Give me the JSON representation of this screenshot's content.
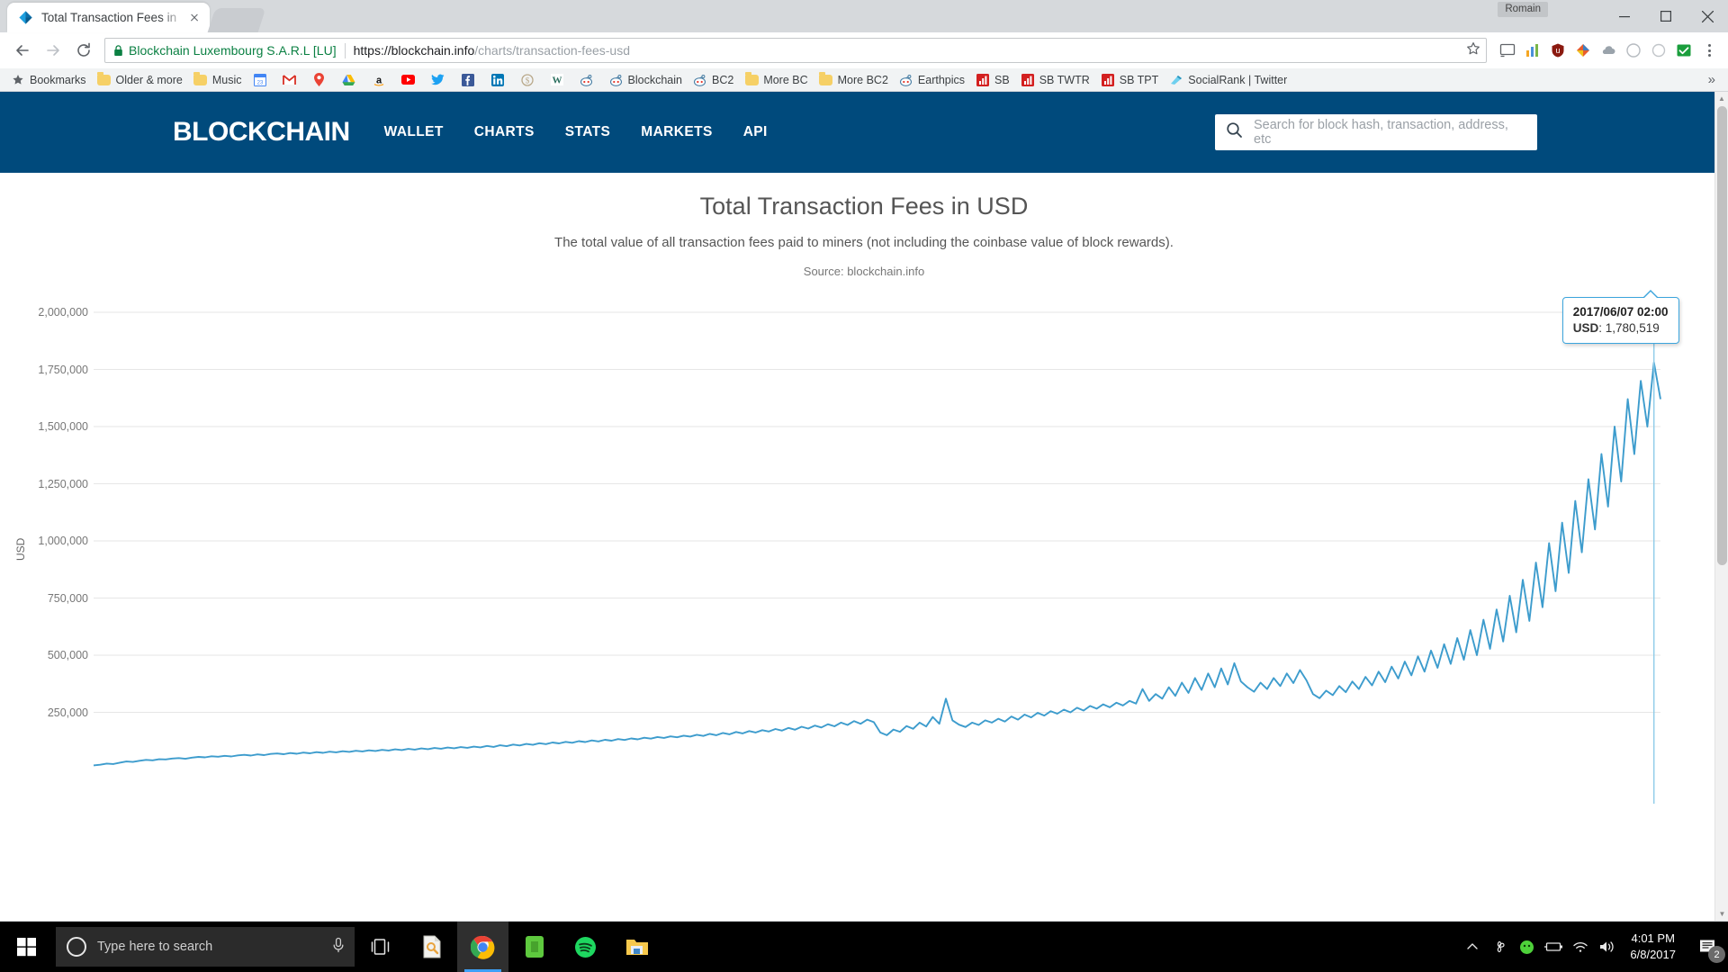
{
  "browser": {
    "tab": {
      "title": "Total Transaction Fees in",
      "favicon": "blockchain-diamond-icon"
    },
    "user_chip": "Romain",
    "omnibox": {
      "security_label": "Blockchain Luxembourg S.A.R.L [LU]",
      "url_domain": "https://blockchain.info",
      "url_path": "/charts/transaction-fees-usd"
    },
    "window_controls": {
      "minimize": "—",
      "maximize": "❐",
      "close": "✕"
    },
    "bookmarks": [
      {
        "label": "Bookmarks",
        "icon": "star-icon"
      },
      {
        "label": "Older & more",
        "icon": "folder-icon"
      },
      {
        "label": "Music",
        "icon": "folder-icon"
      },
      {
        "label": "",
        "icon": "calendar-icon"
      },
      {
        "label": "",
        "icon": "gmail-icon"
      },
      {
        "label": "",
        "icon": "maps-icon"
      },
      {
        "label": "",
        "icon": "drive-icon"
      },
      {
        "label": "",
        "icon": "amazon-icon"
      },
      {
        "label": "",
        "icon": "youtube-icon"
      },
      {
        "label": "",
        "icon": "twitter-icon"
      },
      {
        "label": "",
        "icon": "facebook-icon"
      },
      {
        "label": "",
        "icon": "linkedin-icon"
      },
      {
        "label": "",
        "icon": "dollar-icon"
      },
      {
        "label": "",
        "icon": "w-icon"
      },
      {
        "label": "",
        "icon": "reddit-icon"
      },
      {
        "label": "Blockchain",
        "icon": "reddit-icon"
      },
      {
        "label": "BC2",
        "icon": "reddit-icon"
      },
      {
        "label": "More BC",
        "icon": "folder-icon"
      },
      {
        "label": "More BC2",
        "icon": "folder-icon"
      },
      {
        "label": "Earthpics",
        "icon": "reddit-icon"
      },
      {
        "label": "SB",
        "icon": "chart-red-icon"
      },
      {
        "label": "SB TWTR",
        "icon": "chart-red-icon"
      },
      {
        "label": "SB TPT",
        "icon": "chart-red-icon"
      },
      {
        "label": "SocialRank | Twitter",
        "icon": "socialrank-icon"
      }
    ],
    "bookmarks_overflow": "»",
    "extensions": [
      "cast-icon",
      "analytics-icon",
      "ublock-icon",
      "palette-icon",
      "cloud-icon",
      "ghost-icon",
      "circle-icon",
      "checkbox-green-icon",
      "menu-dots-icon"
    ]
  },
  "site": {
    "logo": "BLOCKCHAIN",
    "nav": [
      "WALLET",
      "CHARTS",
      "STATS",
      "MARKETS",
      "API"
    ],
    "search_placeholder": "Search for block hash, transaction, address, etc"
  },
  "tooltip": {
    "date": "2017/06/07 02:00",
    "series_label": "USD",
    "value": "1,780,519"
  },
  "taskbar": {
    "search_placeholder": "Type here to search",
    "apps": [
      "task-view-icon",
      "acrobat-icon",
      "chrome-icon",
      "evernote-icon",
      "spotify-icon",
      "file-explorer-icon"
    ],
    "tray": [
      "chevron-up-icon",
      "fan-icon",
      "evernote-tray-icon",
      "battery-icon",
      "wifi-icon",
      "volume-icon"
    ],
    "time": "4:01 PM",
    "date": "6/8/2017",
    "notification_count": "2"
  },
  "chart_data": {
    "type": "line",
    "title": "Total Transaction Fees in USD",
    "subtitle": "The total value of all transaction fees paid to miners (not including the coinbase value of block rewards).",
    "source": "Source: blockchain.info",
    "xlabel": "",
    "ylabel": "USD",
    "ylim": [
      0,
      2000000
    ],
    "yticks": [
      "250,000",
      "500,000",
      "750,000",
      "1,000,000",
      "1,250,000",
      "1,500,000",
      "1,750,000",
      "2,000,000"
    ],
    "ytick_values": [
      250000,
      500000,
      750000,
      1000000,
      1250000,
      1500000,
      1750000,
      2000000
    ],
    "grid": true,
    "legend": "none",
    "line_color": "#3d9ccd",
    "highlight_point": {
      "x_label": "2017/06/07 02:00",
      "y": 1780519
    },
    "values": [
      18000,
      21000,
      26000,
      24000,
      30000,
      35000,
      33000,
      38000,
      42000,
      40000,
      45000,
      44000,
      48000,
      50000,
      47000,
      52000,
      55000,
      53000,
      58000,
      56000,
      60000,
      57000,
      62000,
      64000,
      61000,
      66000,
      63000,
      68000,
      70000,
      67000,
      72000,
      69000,
      74000,
      71000,
      76000,
      73000,
      78000,
      75000,
      80000,
      77000,
      82000,
      79000,
      84000,
      81000,
      86000,
      83000,
      88000,
      85000,
      90000,
      87000,
      92000,
      89000,
      94000,
      91000,
      96000,
      93000,
      98000,
      95000,
      100000,
      97000,
      103000,
      99000,
      106000,
      102000,
      109000,
      105000,
      112000,
      108000,
      115000,
      111000,
      118000,
      114000,
      121000,
      117000,
      124000,
      120000,
      127000,
      123000,
      130000,
      126000,
      133000,
      129000,
      136000,
      132000,
      139000,
      135000,
      142000,
      138000,
      145000,
      141000,
      148000,
      144000,
      152000,
      147000,
      156000,
      150000,
      160000,
      154000,
      164000,
      158000,
      168000,
      162000,
      172000,
      166000,
      177000,
      170000,
      182000,
      174000,
      187000,
      179000,
      192000,
      184000,
      198000,
      189000,
      205000,
      195000,
      212000,
      200000,
      218000,
      207000,
      162000,
      150000,
      175000,
      165000,
      190000,
      178000,
      205000,
      188000,
      230000,
      200000,
      310000,
      215000,
      196000,
      186000,
      205000,
      195000,
      215000,
      205000,
      222000,
      210000,
      232000,
      218000,
      240000,
      228000,
      248000,
      236000,
      255000,
      244000,
      262000,
      250000,
      270000,
      258000,
      278000,
      266000,
      285000,
      272000,
      292000,
      280000,
      300000,
      288000,
      352000,
      300000,
      330000,
      310000,
      360000,
      322000,
      380000,
      335000,
      400000,
      348000,
      420000,
      360000,
      442000,
      372000,
      465000,
      385000,
      360000,
      340000,
      380000,
      352000,
      400000,
      365000,
      420000,
      378000,
      435000,
      390000,
      330000,
      312000,
      345000,
      325000,
      365000,
      338000,
      385000,
      352000,
      405000,
      368000,
      428000,
      382000,
      450000,
      398000,
      472000,
      412000,
      495000,
      428000,
      520000,
      445000,
      548000,
      462000,
      575000,
      480000,
      610000,
      500000,
      655000,
      528000,
      700000,
      560000,
      760000,
      600000,
      830000,
      650000,
      905000,
      710000,
      990000,
      780000,
      1080000,
      860000,
      1175000,
      950000,
      1270000,
      1050000,
      1380000,
      1150000,
      1500000,
      1260000,
      1620000,
      1380000,
      1700000,
      1500000,
      1780519,
      1620000
    ],
    "n_points": 240
  }
}
